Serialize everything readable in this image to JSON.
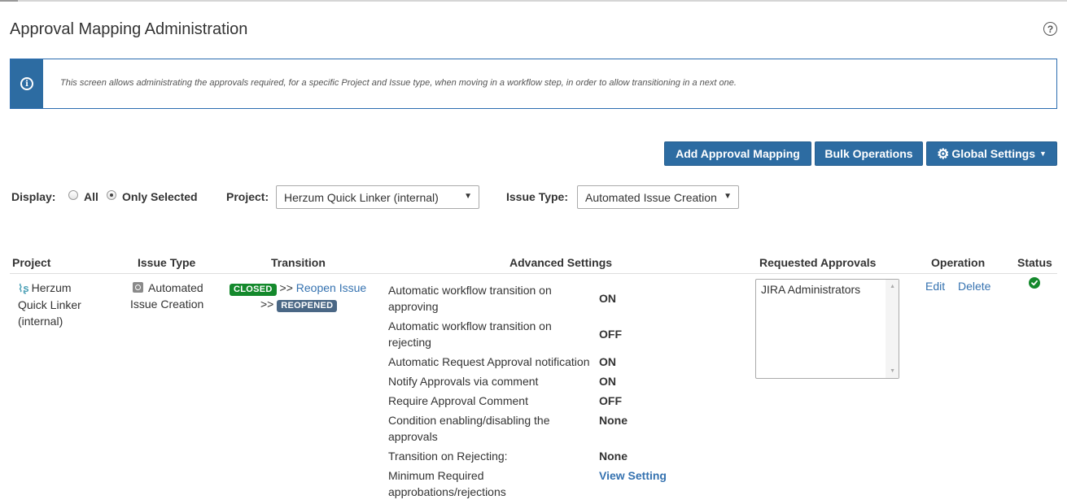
{
  "page": {
    "title": "Approval Mapping Administration",
    "help_icon": "question-circle-icon"
  },
  "info": {
    "icon": "info-icon",
    "text": "This screen allows administrating the approvals required, for a specific Project and Issue type, when moving in a workflow step, in order to allow transitioning in a next one."
  },
  "toolbar": {
    "add_label": "Add Approval Mapping",
    "bulk_label": "Bulk Operations",
    "global_label": "Global Settings"
  },
  "filters": {
    "display_label": "Display:",
    "display_all": "All",
    "display_selected": "Only Selected",
    "display_value": "Only Selected",
    "project_label": "Project:",
    "project_value": "Herzum Quick Linker (internal)",
    "issue_type_label": "Issue Type:",
    "issue_type_value": "Automated Issue Creation"
  },
  "table": {
    "headers": {
      "project": "Project",
      "issue_type": "Issue Type",
      "transition": "Transition",
      "advanced": "Advanced Settings",
      "approvals": "Requested Approvals",
      "operation": "Operation",
      "status": "Status"
    },
    "row": {
      "project_line1": "Herzum",
      "project_line2": "Quick Linker",
      "project_line3": "(internal)",
      "issue_type_line1": "Automated",
      "issue_type_line2": "Issue Creation",
      "from_status": "CLOSED",
      "arrow1": ">>",
      "transition_name": "Reopen Issue",
      "arrow2": ">>",
      "to_status": "REOPENED",
      "settings": [
        {
          "label_line1": "Automatic workflow transition on",
          "label_line2": "approving",
          "value": "ON"
        },
        {
          "label_line1": "Automatic workflow transition on",
          "label_line2": "rejecting",
          "value": "OFF"
        },
        {
          "label_line1": "Automatic Request Approval notification",
          "label_line2": "",
          "value": "ON"
        },
        {
          "label_line1": "Notify Approvals via comment",
          "label_line2": "",
          "value": "ON"
        },
        {
          "label_line1": "Require Approval Comment",
          "label_line2": "",
          "value": "OFF"
        },
        {
          "label_line1": "Condition enabling/disabling the",
          "label_line2": "approvals",
          "value": "None"
        },
        {
          "label_line1": "Transition on Rejecting:",
          "label_line2": "",
          "value": "None"
        },
        {
          "label_line1": "Minimum Required",
          "label_line2": "approbations/rejections",
          "value": "View Setting"
        }
      ],
      "approvals": [
        "JIRA Administrators"
      ],
      "edit_label": "Edit",
      "delete_label": "Delete",
      "status_icon": "check-circle-icon"
    }
  },
  "colors": {
    "primary": "#2d6ca2",
    "link": "#3572b0",
    "success": "#14892c",
    "status_blue": "#4a6785"
  }
}
